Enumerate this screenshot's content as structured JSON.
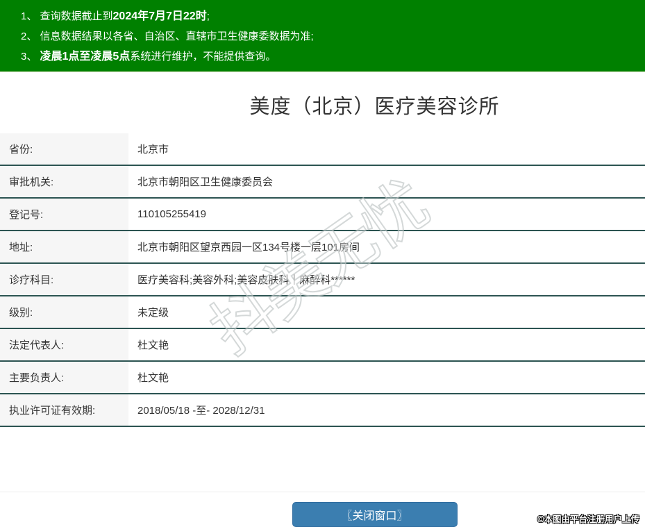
{
  "page": {
    "title": "美度（北京）医疗美容诊所"
  },
  "notice": {
    "bg_color": "#008000",
    "lines": [
      {
        "prefix": "1、 查询数据截止到",
        "bold": "2024年7月7日22时",
        "suffix": ";"
      },
      {
        "prefix": "2、 信息数据结果以各省、自治区、直辖市卫生健康委数据为准;",
        "bold": "",
        "suffix": ""
      },
      {
        "prefix": "3、 ",
        "bold": "凌晨1点至凌晨5点",
        "suffix": "系统进行维护，不能提供查询。"
      }
    ]
  },
  "table": {
    "rows": [
      {
        "label": "省份:",
        "value": "北京市"
      },
      {
        "label": "审批机关:",
        "value": "北京市朝阳区卫生健康委员会"
      },
      {
        "label": "登记号:",
        "value": "110105255419"
      },
      {
        "label": "地址:",
        "value": "北京市朝阳区望京西园一区134号楼一层101房间"
      },
      {
        "label": "诊疗科目:",
        "value": "医疗美容科;美容外科;美容皮肤科｜麻醉科******"
      },
      {
        "label": "级别:",
        "value": "未定级"
      },
      {
        "label": "法定代表人:",
        "value": "杜文艳"
      },
      {
        "label": "主要负责人:",
        "value": "杜文艳"
      },
      {
        "label": "执业许可证有效期:",
        "value": "2018/05/18 -至- 2028/12/31"
      }
    ]
  },
  "footer": {
    "close_button_label": "〖关闭窗口〗",
    "button_color": "#3b7eb0"
  },
  "watermarks": {
    "diagonal_text": "抖美无忧",
    "credit_text": "©本图由平台注册用户上传"
  },
  "colors": {
    "notice_green": "#008000",
    "row_divider": "#2c5452",
    "label_bg": "#f6f6f6",
    "button_blue": "#3b7eb0"
  }
}
